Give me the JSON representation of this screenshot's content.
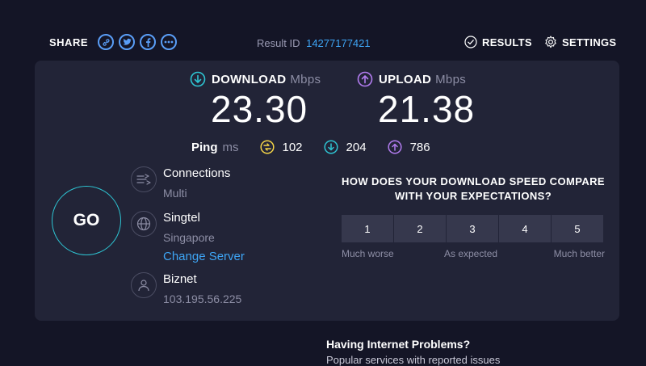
{
  "header": {
    "share_label": "SHARE",
    "share_icons": [
      "link-icon",
      "twitter-icon",
      "facebook-icon",
      "more-icon"
    ],
    "result_id_label": "Result ID",
    "result_id_value": "14277177421",
    "results_label": "RESULTS",
    "settings_label": "SETTINGS"
  },
  "download": {
    "label": "DOWNLOAD",
    "unit": "Mbps",
    "value": "23.30"
  },
  "upload": {
    "label": "UPLOAD",
    "unit": "Mbps",
    "value": "21.38"
  },
  "ping": {
    "label": "Ping",
    "unit": "ms",
    "idle": "102",
    "download": "204",
    "upload": "786"
  },
  "go_label": "GO",
  "connections": {
    "title": "Connections",
    "value": "Multi"
  },
  "server": {
    "name": "Singtel",
    "location": "Singapore",
    "change_label": "Change Server"
  },
  "provider": {
    "name": "Biznet",
    "ip": "103.195.56.225"
  },
  "survey": {
    "question_line1": "HOW DOES YOUR DOWNLOAD SPEED COMPARE",
    "question_line2": "WITH YOUR EXPECTATIONS?",
    "options": [
      "1",
      "2",
      "3",
      "4",
      "5"
    ],
    "label_low": "Much worse",
    "label_mid": "As expected",
    "label_high": "Much better"
  },
  "footer": {
    "problems_title": "Having Internet Problems?",
    "problems_sub": "Popular services with reported issues"
  },
  "colors": {
    "background": "#141526",
    "panel": "#222437",
    "download_accent": "#2ec5d3",
    "upload_accent": "#b27cf0",
    "ping_accent": "#f5d547",
    "link": "#3ea5f5"
  }
}
